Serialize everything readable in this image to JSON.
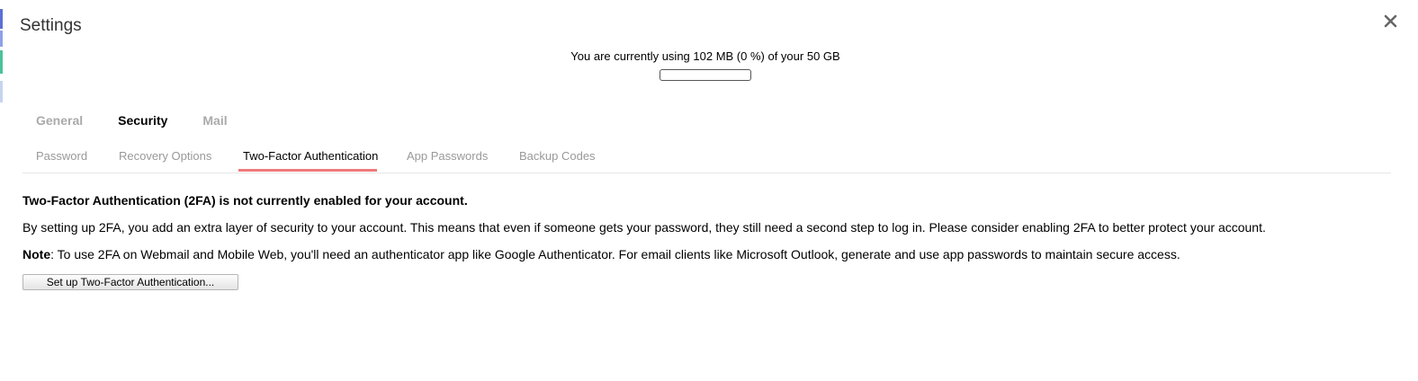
{
  "dialog": {
    "title": "Settings",
    "close_icon": "close-icon"
  },
  "quota": {
    "text": "You are currently using 102 MB (0 %) of your 50 GB",
    "used_percent": 0
  },
  "main_tabs": [
    {
      "label": "General",
      "active": false
    },
    {
      "label": "Security",
      "active": true
    },
    {
      "label": "Mail",
      "active": false
    }
  ],
  "sub_tabs": [
    {
      "label": "Password",
      "active": false
    },
    {
      "label": "Recovery Options",
      "active": false
    },
    {
      "label": "Two-Factor Authentication",
      "active": true
    },
    {
      "label": "App Passwords",
      "active": false
    },
    {
      "label": "Backup Codes",
      "active": false
    }
  ],
  "content": {
    "heading": "Two-Factor Authentication (2FA) is not currently enabled for your account.",
    "description": "By setting up 2FA, you add an extra layer of security to your account. This means that even if someone gets your password, they still need a second step to log in. Please consider enabling 2FA to better protect your account.",
    "note_label": "Note",
    "note_text": ": To use 2FA on Webmail and Mobile Web, you'll need an authenticator app like Google Authenticator. For email clients like Microsoft Outlook, generate and use app passwords to maintain secure access.",
    "setup_button": "Set up Two-Factor Authentication..."
  },
  "colors": {
    "active_tab_underline": "#f07a7a",
    "inactive_tab": "#999999",
    "left_edge": [
      "#5b6fd6",
      "#4bc29a",
      "#c7d3ee"
    ]
  }
}
